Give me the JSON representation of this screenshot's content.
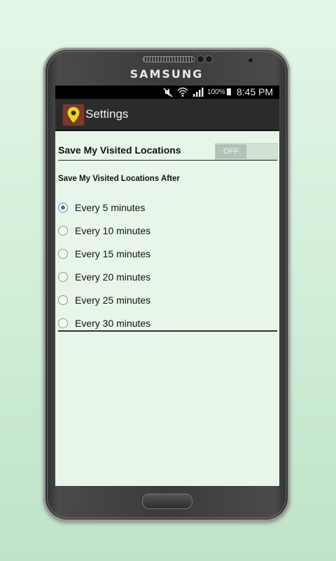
{
  "device": {
    "brand": "SAMSUNG"
  },
  "status_bar": {
    "icons": [
      "mute-icon",
      "wifi-icon",
      "signal-icon",
      "battery-icon"
    ],
    "battery": "100%",
    "time": "8:45 PM"
  },
  "app_bar": {
    "icon": "location-pin-icon",
    "title": "Settings"
  },
  "settings": {
    "visited_locations": {
      "label": "Save My Visited Locations",
      "toggle_state": "OFF"
    },
    "interval": {
      "label": "Save My Visited Locations After",
      "options": [
        {
          "label": "Every 5 minutes",
          "checked": true
        },
        {
          "label": "Every 10 minutes",
          "checked": false
        },
        {
          "label": "Every 15 minutes",
          "checked": false
        },
        {
          "label": "Every 20 minutes",
          "checked": false
        },
        {
          "label": "Every 25 minutes",
          "checked": false
        },
        {
          "label": "Every 30 minutes",
          "checked": false
        }
      ]
    }
  },
  "colors": {
    "background": "#d3efda",
    "screen": "#e8f6ea",
    "app_bar": "#2b2b2b",
    "radio_accent": "#2d7fa6"
  }
}
